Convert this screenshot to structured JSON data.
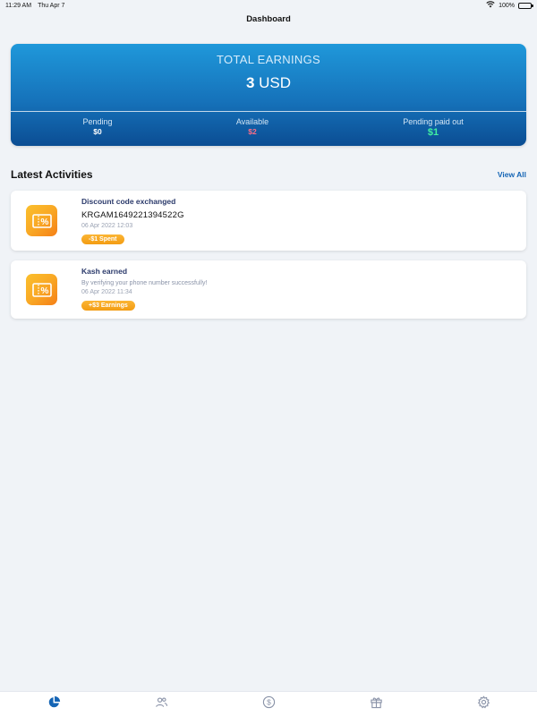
{
  "status_bar": {
    "time": "11:29 AM",
    "date": "Thu Apr 7",
    "battery": "100%"
  },
  "header": {
    "title": "Dashboard"
  },
  "earnings": {
    "label": "TOTAL EARNINGS",
    "amount": "3",
    "currency": "USD",
    "stats": [
      {
        "label": "Pending",
        "value": "$0"
      },
      {
        "label": "Available",
        "value": "$2"
      },
      {
        "label": "Pending paid out",
        "value": "$1"
      }
    ]
  },
  "activities_section": {
    "title": "Latest Activities",
    "view_all": "View All"
  },
  "activities": [
    {
      "title": "Discount code exchanged",
      "code": "KRGAM1649221394522G",
      "date": "06 Apr 2022 12:03",
      "badge": "-$1 Spent"
    },
    {
      "title": "Kash earned",
      "description": "By verifying your phone number successfully!",
      "date": "06 Apr 2022 11:34",
      "badge": "+$3 Earnings"
    }
  ],
  "tabs": [
    {
      "icon": "pie-chart-icon",
      "active": true
    },
    {
      "icon": "users-icon",
      "active": false
    },
    {
      "icon": "dollar-circle-icon",
      "active": false
    },
    {
      "icon": "gift-icon",
      "active": false
    },
    {
      "icon": "gear-icon",
      "active": false
    }
  ],
  "colors": {
    "accent": "#1565b5",
    "card_gradient_top": "#1f98da",
    "card_gradient_bottom": "#0b4d93",
    "available_value": "#ff6d86",
    "paidout_value": "#41f0a0",
    "badge": "#f5a623"
  }
}
